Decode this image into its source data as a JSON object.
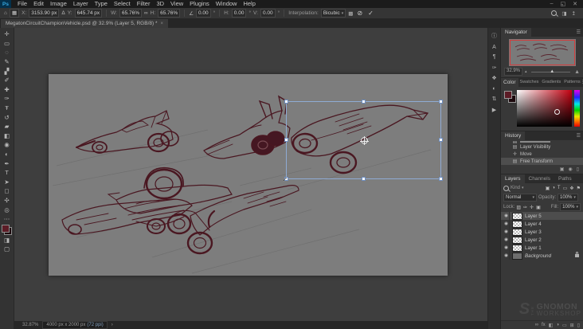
{
  "colors": {
    "accent_blue": "#31a8ff",
    "sketch_ink": "#4a1721",
    "canvas_gray": "#7d7d7d",
    "selection_border": "#8fabd4",
    "navigator_view_border": "#d23c3c"
  },
  "menu": {
    "logo": "Ps",
    "items": [
      "File",
      "Edit",
      "Image",
      "Layer",
      "Type",
      "Select",
      "Filter",
      "3D",
      "View",
      "Plugins",
      "Window",
      "Help"
    ],
    "window_controls": {
      "minimize": "–",
      "restore": "◱",
      "close": "✕"
    }
  },
  "options": {
    "home_icon": "⌂",
    "reference_point_icon": "▦",
    "x_label": "X:",
    "x_value": "3153.90 px",
    "delta_icon": "Δ",
    "y_label": "Y:",
    "y_value": "645.74 px",
    "w_label": "W:",
    "w_value": "65.76%",
    "link_icon": "∞",
    "h_label": "H:",
    "h_value": "65.76%",
    "angle_icon": "∠",
    "angle_value": "0.00",
    "degree": "°",
    "hskew_label": "H:",
    "hskew_value": "0.00",
    "vskew_label": "V:",
    "vskew_value": "0.00",
    "interp_label": "Interpolation:",
    "interp_value": "Bicubic",
    "warp_icon": "▩",
    "cancel_icon": "⊘",
    "commit_icon": "✓",
    "workspace_icon": "◨",
    "share_icon": "↥"
  },
  "tabbar": {
    "title": "MegatonCircuitChampionVehicle.psd @ 32.9% (Layer 5, RGB/8) *",
    "close": "×"
  },
  "toolbar": {
    "tools": [
      {
        "name": "move-tool",
        "glyph": "✛"
      },
      {
        "name": "marquee-tool",
        "glyph": "▭"
      },
      {
        "name": "lasso-tool",
        "glyph": "◌"
      },
      {
        "name": "quick-selection-tool",
        "glyph": "✎"
      },
      {
        "name": "crop-tool",
        "glyph": "▞"
      },
      {
        "name": "eyedropper-tool",
        "glyph": "✐"
      },
      {
        "name": "healing-brush-tool",
        "glyph": "✚"
      },
      {
        "name": "brush-tool",
        "glyph": "✑"
      },
      {
        "name": "clone-stamp-tool",
        "glyph": "Ŧ"
      },
      {
        "name": "history-brush-tool",
        "glyph": "↺"
      },
      {
        "name": "eraser-tool",
        "glyph": "▰"
      },
      {
        "name": "gradient-tool",
        "glyph": "◧"
      },
      {
        "name": "blur-tool",
        "glyph": "◉"
      },
      {
        "name": "dodge-tool",
        "glyph": "◐"
      },
      {
        "name": "pen-tool",
        "glyph": "✒"
      },
      {
        "name": "type-tool",
        "glyph": "T"
      },
      {
        "name": "path-selection-tool",
        "glyph": "➤"
      },
      {
        "name": "shape-tool",
        "glyph": "◻"
      },
      {
        "name": "hand-tool",
        "glyph": "✣"
      },
      {
        "name": "zoom-tool",
        "glyph": "◎"
      }
    ],
    "more_icon": "⋯",
    "foreground_color": "#5c1c26",
    "background_color": "#1d0a0e",
    "quick_mask_icon": "◨",
    "screen_mode_icon": "▢"
  },
  "panelstrip": {
    "icons": [
      {
        "name": "info-panel-icon",
        "glyph": "ⓘ"
      },
      {
        "name": "character-panel-icon",
        "glyph": "A"
      },
      {
        "name": "paragraph-panel-icon",
        "glyph": "¶"
      },
      {
        "name": "brush-settings-panel-icon",
        "glyph": "✑"
      },
      {
        "name": "clone-source-panel-icon",
        "glyph": "❖"
      },
      {
        "name": "adjustments-panel-icon",
        "glyph": "◐"
      },
      {
        "name": "properties-panel-icon",
        "glyph": "⇅"
      },
      {
        "name": "actions-panel-icon",
        "glyph": "▶"
      }
    ]
  },
  "navigator": {
    "title": "Navigator",
    "menu_icon": "☰",
    "zoom": "32.9%",
    "slider_small_icon": "▴",
    "slider_large_icon": "▲",
    "slider_thumb": "▲"
  },
  "color_panel": {
    "tabs": [
      "Color",
      "Swatches",
      "Gradients",
      "Patterns"
    ],
    "menu_icon": "☰"
  },
  "history": {
    "title": "History",
    "menu_icon": "☰",
    "items": [
      {
        "label": "Layer Visibility",
        "icon": "▤"
      },
      {
        "label": "Move",
        "icon": "✛"
      },
      {
        "label": "Free Transform",
        "icon": "▤"
      }
    ],
    "footer_icons": [
      {
        "name": "new-doc-from-state-icon",
        "glyph": "▣"
      },
      {
        "name": "new-snapshot-icon",
        "glyph": "◉"
      },
      {
        "name": "delete-state-icon",
        "glyph": "▯"
      }
    ]
  },
  "layers": {
    "tabs": [
      "Layers",
      "Channels",
      "Paths"
    ],
    "filter_kind_label": "Kind",
    "filter_icons": [
      {
        "name": "filter-pixel-layers-icon",
        "glyph": "▣"
      },
      {
        "name": "filter-adjustment-layers-icon",
        "glyph": "◑"
      },
      {
        "name": "filter-type-layers-icon",
        "glyph": "T"
      },
      {
        "name": "filter-shape-layers-icon",
        "glyph": "▭"
      },
      {
        "name": "filter-smart-objects-icon",
        "glyph": "❖"
      },
      {
        "name": "filter-toggle-icon",
        "glyph": "⚑"
      }
    ],
    "blend_mode": "Normal",
    "opacity_label": "Opacity:",
    "opacity_value": "100%",
    "lock_label": "Lock:",
    "lock_icons": [
      {
        "name": "lock-transparency-icon",
        "glyph": "▨"
      },
      {
        "name": "lock-paint-icon",
        "glyph": "✑"
      },
      {
        "name": "lock-move-icon",
        "glyph": "✛"
      },
      {
        "name": "lock-all-icon",
        "glyph": "▣"
      }
    ],
    "fill_label": "Fill:",
    "fill_value": "100%",
    "rows": [
      {
        "name": "Layer 5",
        "selected": true
      },
      {
        "name": "Layer 4"
      },
      {
        "name": "Layer 3"
      },
      {
        "name": "Layer 2"
      },
      {
        "name": "Layer 1"
      },
      {
        "name": "Background",
        "locked": true
      }
    ],
    "footer_icons": [
      {
        "name": "link-layers-icon",
        "glyph": "∞"
      },
      {
        "name": "layer-effects-icon",
        "glyph": "fx"
      },
      {
        "name": "add-layer-mask-icon",
        "glyph": "◧"
      },
      {
        "name": "adjustment-layer-icon",
        "glyph": "◑"
      },
      {
        "name": "new-group-icon",
        "glyph": "▭"
      },
      {
        "name": "new-layer-icon",
        "glyph": "⊞"
      },
      {
        "name": "delete-layer-icon",
        "glyph": "▯"
      }
    ]
  },
  "statusbar": {
    "zoom": "32.87%",
    "doc_info": "4000 px x 2000 px",
    "ppi": "(72 ppi)",
    "arrow": "›"
  },
  "watermark": {
    "logo": "S",
    "the": "THE",
    "line1": "GNOMON",
    "line2": "WORKSHOP"
  }
}
